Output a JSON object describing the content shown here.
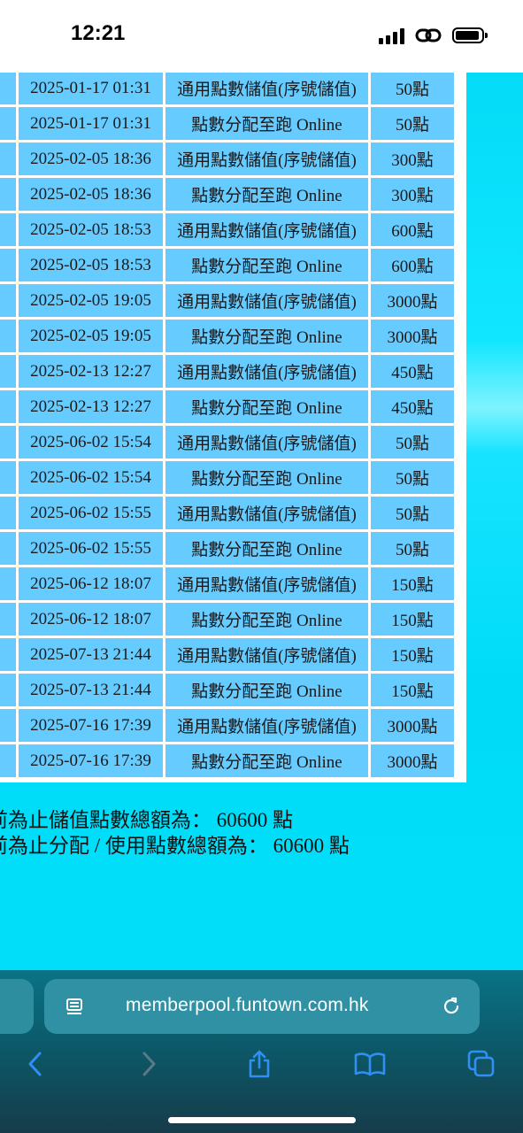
{
  "status_bar": {
    "time": "12:21"
  },
  "table": {
    "rows": [
      {
        "date": "2025-01-17 01:31",
        "description": "通用點數儲值(序號儲值)",
        "points": "50點"
      },
      {
        "date": "2025-01-17 01:31",
        "description": "點數分配至跑 Online",
        "points": "50點"
      },
      {
        "date": "2025-02-05 18:36",
        "description": "通用點數儲值(序號儲值)",
        "points": "300點"
      },
      {
        "date": "2025-02-05 18:36",
        "description": "點數分配至跑 Online",
        "points": "300點"
      },
      {
        "date": "2025-02-05 18:53",
        "description": "通用點數儲值(序號儲值)",
        "points": "600點"
      },
      {
        "date": "2025-02-05 18:53",
        "description": "點數分配至跑 Online",
        "points": "600點"
      },
      {
        "date": "2025-02-05 19:05",
        "description": "通用點數儲值(序號儲值)",
        "points": "3000點"
      },
      {
        "date": "2025-02-05 19:05",
        "description": "點數分配至跑 Online",
        "points": "3000點"
      },
      {
        "date": "2025-02-13 12:27",
        "description": "通用點數儲值(序號儲值)",
        "points": "450點"
      },
      {
        "date": "2025-02-13 12:27",
        "description": "點數分配至跑 Online",
        "points": "450點"
      },
      {
        "date": "2025-06-02 15:54",
        "description": "通用點數儲值(序號儲值)",
        "points": "50點"
      },
      {
        "date": "2025-06-02 15:54",
        "description": "點數分配至跑 Online",
        "points": "50點"
      },
      {
        "date": "2025-06-02 15:55",
        "description": "通用點數儲值(序號儲值)",
        "points": "50點"
      },
      {
        "date": "2025-06-02 15:55",
        "description": "點數分配至跑 Online",
        "points": "50點"
      },
      {
        "date": "2025-06-12 18:07",
        "description": "通用點數儲值(序號儲值)",
        "points": "150點"
      },
      {
        "date": "2025-06-12 18:07",
        "description": "點數分配至跑 Online",
        "points": "150點"
      },
      {
        "date": "2025-07-13 21:44",
        "description": "通用點數儲值(序號儲值)",
        "points": "150點"
      },
      {
        "date": "2025-07-13 21:44",
        "description": "點數分配至跑 Online",
        "points": "150點"
      },
      {
        "date": "2025-07-16 17:39",
        "description": "通用點數儲值(序號儲值)",
        "points": "3000點"
      },
      {
        "date": "2025-07-16 17:39",
        "description": "點數分配至跑 Online",
        "points": "3000點"
      }
    ]
  },
  "totals": {
    "stored_line": "前為止儲值點數總額為： 60600 點",
    "used_line": "前為止分配 / 使用點數總額為： 60600 點"
  },
  "browser": {
    "url": "memberpool.funtown.com.hk",
    "toolbar": [
      "back-icon",
      "forward-icon",
      "share-icon",
      "bookmarks-icon",
      "tabs-icon"
    ]
  },
  "colors": {
    "cell_background": "#66cbff",
    "page_background": "#00dcf8",
    "chrome_background": "#0b5a6a"
  }
}
